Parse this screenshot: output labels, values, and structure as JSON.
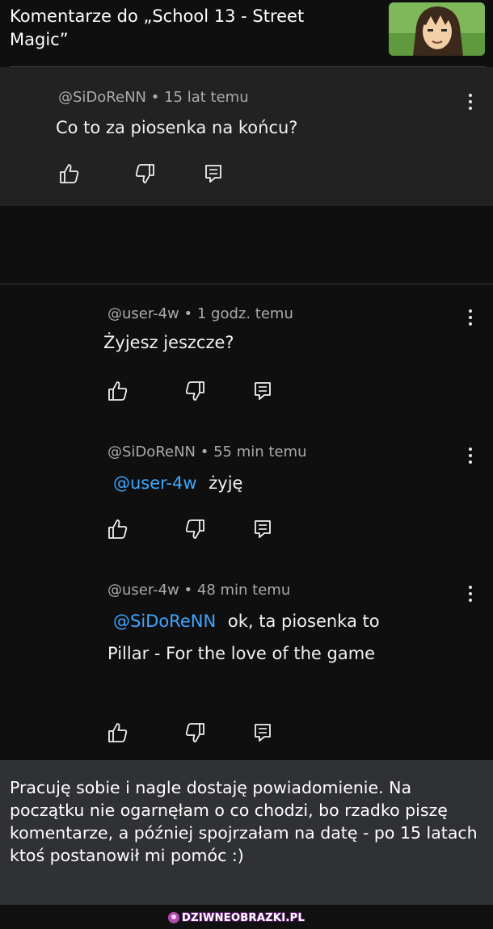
{
  "header": {
    "title_line1": "Komentarze do „School 13 - Street",
    "title_line2": "Magic”"
  },
  "op_comment": {
    "author": "@SiDoReNN",
    "time": "15 lat temu",
    "text": "Co to za piosenka na końcu?"
  },
  "replies": [
    {
      "author": "@user-4w",
      "time": "1 godz. temu",
      "mention": "",
      "text": "Żyjesz jeszcze?",
      "text2": ""
    },
    {
      "author": "@SiDoReNN",
      "time": "55 min temu",
      "mention": "@user-4w",
      "text": "żyję",
      "text2": ""
    },
    {
      "author": "@user-4w",
      "time": "48 min temu",
      "mention": "@SiDoReNN",
      "text": "ok, ta piosenka to",
      "text2": "Pillar - For the love of the game"
    }
  ],
  "meta_separator": "•",
  "icons": [
    "like-icon",
    "dislike-icon",
    "reply-icon",
    "more-vert-icon"
  ],
  "caption": {
    "text": "Pracuję sobie i nagle dostaję powiadomienie. Na początku nie ogarnęłam o co chodzi, bo rzadko piszę komentarze, a później spojrzałam na datę - po 15 latach ktoś postanowił mi pomóc :)"
  },
  "watermark": "DZIWNEOBRAZKI.PL",
  "colors": {
    "background": "#0f0f10",
    "op_background": "#222223",
    "caption_background": "#303134",
    "mention": "#3ea6ff",
    "meta_text": "#aaaaaa"
  }
}
